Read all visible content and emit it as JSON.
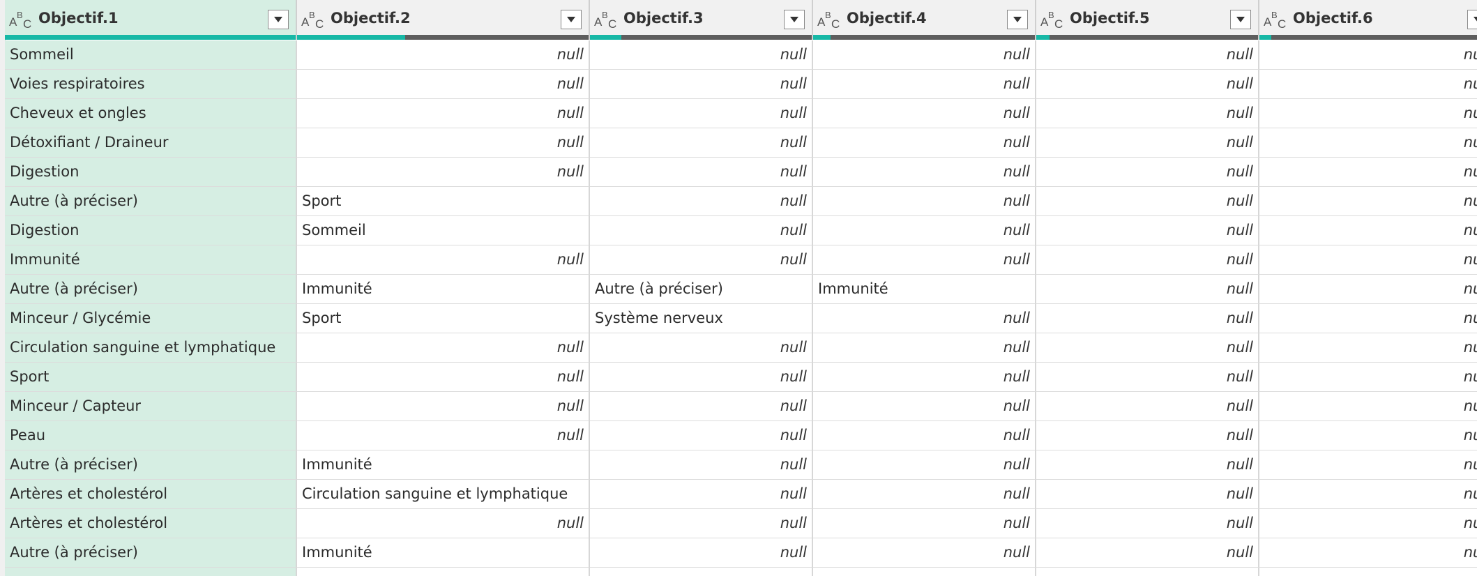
{
  "colors": {
    "header_bg": "#f1f1f1",
    "selected_bg": "#d6eee3",
    "quality_valid": "#17b8a6",
    "quality_other": "#5e5e5e",
    "grid_line": "#d7d7d7"
  },
  "columns": [
    {
      "title": "Objectif.1",
      "type_icon": "text-type-icon",
      "selected": true,
      "valid_fraction": 1.0
    },
    {
      "title": "Objectif.2",
      "type_icon": "text-type-icon",
      "selected": false,
      "valid_fraction": 0.37
    },
    {
      "title": "Objectif.3",
      "type_icon": "text-type-icon",
      "selected": false,
      "valid_fraction": 0.14
    },
    {
      "title": "Objectif.4",
      "type_icon": "text-type-icon",
      "selected": false,
      "valid_fraction": 0.08
    },
    {
      "title": "Objectif.5",
      "type_icon": "text-type-icon",
      "selected": false,
      "valid_fraction": 0.06
    },
    {
      "title": "Objectif.6",
      "type_icon": "text-type-icon",
      "selected": false,
      "valid_fraction": 0.05
    }
  ],
  "rows": [
    [
      "Sommeil",
      "null",
      "null",
      "null",
      "null",
      "null"
    ],
    [
      "Voies respiratoires",
      "null",
      "null",
      "null",
      "null",
      "null"
    ],
    [
      "Cheveux et ongles",
      "null",
      "null",
      "null",
      "null",
      "null"
    ],
    [
      "Détoxifiant / Draineur",
      "null",
      "null",
      "null",
      "null",
      "null"
    ],
    [
      "Digestion",
      "null",
      "null",
      "null",
      "null",
      "null"
    ],
    [
      "Autre (à préciser)",
      "Sport",
      "null",
      "null",
      "null",
      "null"
    ],
    [
      "Digestion",
      "Sommeil",
      "null",
      "null",
      "null",
      "null"
    ],
    [
      "Immunité",
      "null",
      "null",
      "null",
      "null",
      "null"
    ],
    [
      "Autre (à préciser)",
      "Immunité",
      "Autre (à préciser)",
      "Immunité",
      "null",
      "null"
    ],
    [
      "Minceur / Glycémie",
      "Sport",
      "Système nerveux",
      "null",
      "null",
      "null"
    ],
    [
      "Circulation sanguine et lymphatique",
      "null",
      "null",
      "null",
      "null",
      "null"
    ],
    [
      "Sport",
      "null",
      "null",
      "null",
      "null",
      "null"
    ],
    [
      "Minceur / Capteur",
      "null",
      "null",
      "null",
      "null",
      "null"
    ],
    [
      "Peau",
      "null",
      "null",
      "null",
      "null",
      "null"
    ],
    [
      "Autre (à préciser)",
      "Immunité",
      "null",
      "null",
      "null",
      "null"
    ],
    [
      "Artères et cholestérol",
      "Circulation sanguine et lymphatique",
      "null",
      "null",
      "null",
      "null"
    ],
    [
      "Artères et cholestérol",
      "null",
      "null",
      "null",
      "null",
      "null"
    ],
    [
      "Autre (à préciser)",
      "Immunité",
      "null",
      "null",
      "null",
      "null"
    ],
    [
      "",
      "",
      "",
      "",
      "",
      ""
    ]
  ]
}
